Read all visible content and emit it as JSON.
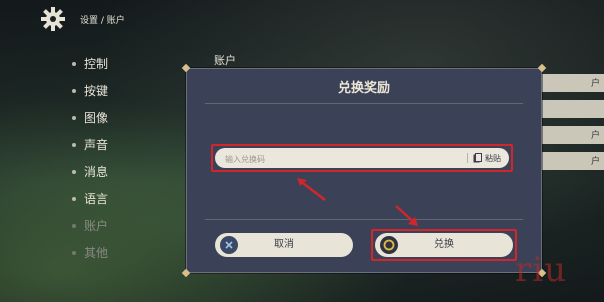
{
  "header": {
    "breadcrumb": "设置 / 账户"
  },
  "sidebar": {
    "items": [
      {
        "label": "控制"
      },
      {
        "label": "按键"
      },
      {
        "label": "图像"
      },
      {
        "label": "声音"
      },
      {
        "label": "消息"
      },
      {
        "label": "语言"
      },
      {
        "label": "账户"
      },
      {
        "label": "其他"
      }
    ]
  },
  "section": {
    "title": "账户"
  },
  "background_buttons": [
    "户",
    "",
    "户",
    "户"
  ],
  "dialog": {
    "title": "兑换奖励",
    "input_placeholder": "输入兑换码",
    "paste_label": "粘贴",
    "cancel_label": "取消",
    "confirm_label": "兑换"
  },
  "watermark": "riu",
  "colors": {
    "highlight": "#d1262b",
    "accent": "#d9c08a",
    "dialog_bg": "#3b4257"
  }
}
